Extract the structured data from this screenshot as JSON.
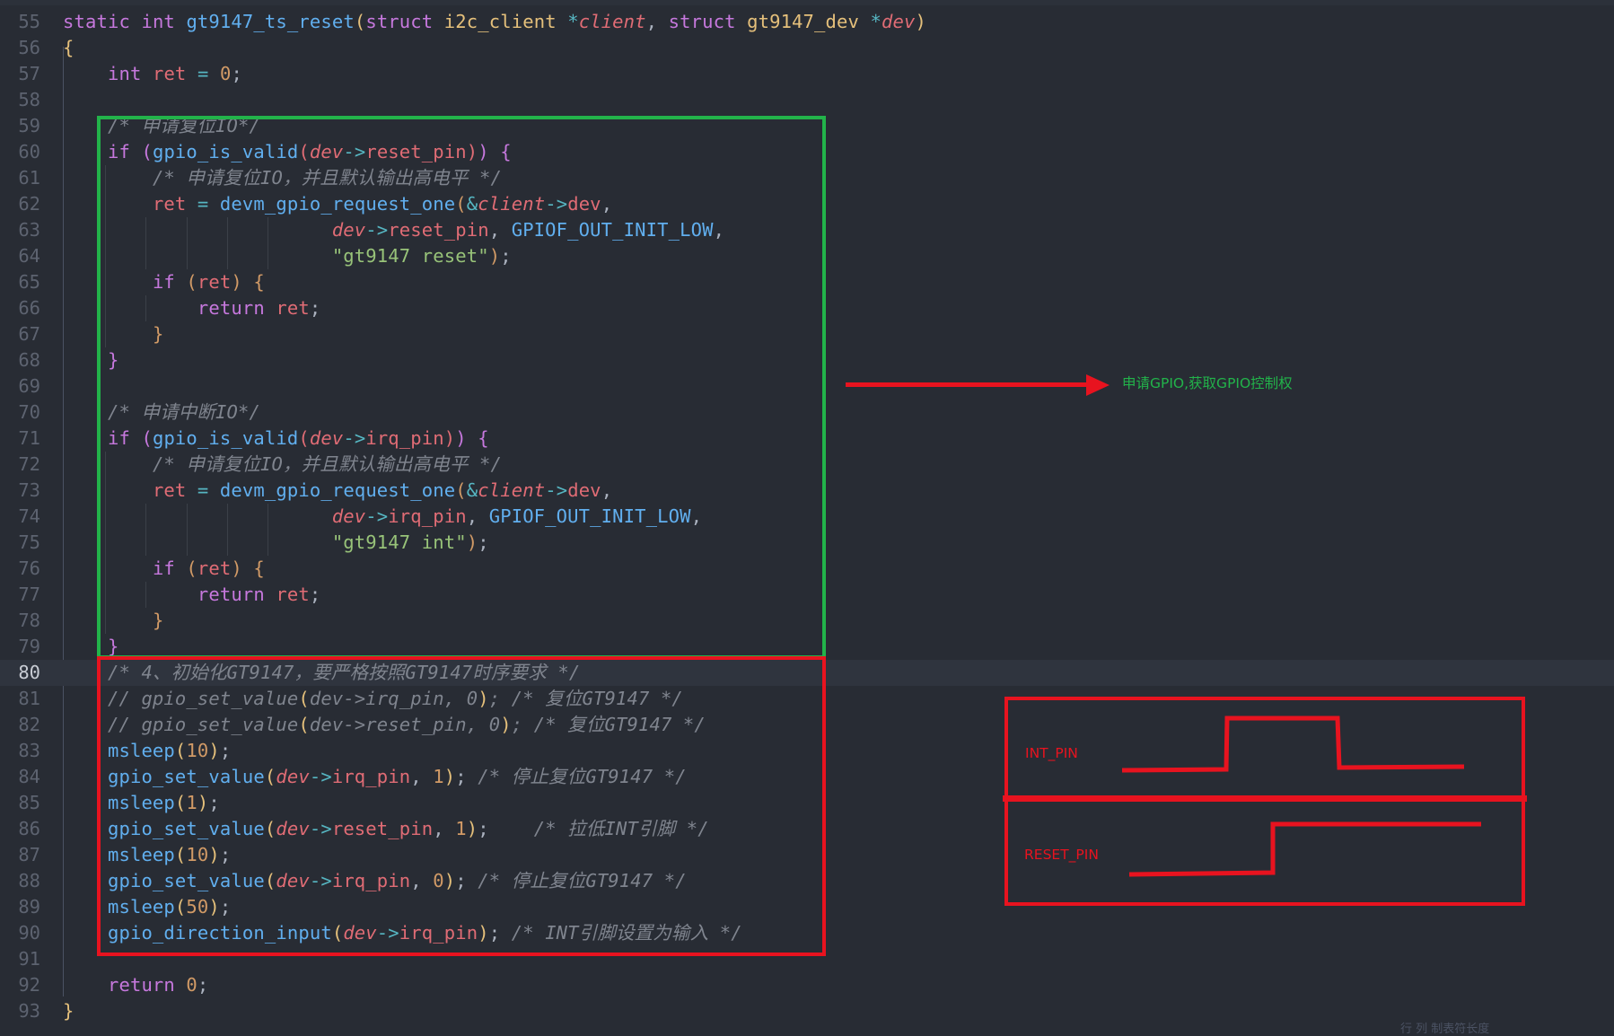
{
  "editor": {
    "current_line": "80",
    "lines": [
      {
        "no": "55",
        "tokens": [
          {
            "t": "static",
            "c": "kw"
          },
          {
            "t": " "
          },
          {
            "t": "int",
            "c": "ty"
          },
          {
            "t": " "
          },
          {
            "t": "gt9147_ts_reset",
            "c": "fn"
          },
          {
            "t": "(",
            "c": "b1"
          },
          {
            "t": "struct",
            "c": "kw"
          },
          {
            "t": " "
          },
          {
            "t": "i2c_client",
            "c": "st"
          },
          {
            "t": " "
          },
          {
            "t": "*",
            "c": "op"
          },
          {
            "t": "client",
            "c": "pa"
          },
          {
            "t": ", "
          },
          {
            "t": "struct",
            "c": "kw"
          },
          {
            "t": " "
          },
          {
            "t": "gt9147_dev",
            "c": "st"
          },
          {
            "t": " "
          },
          {
            "t": "*",
            "c": "op"
          },
          {
            "t": "dev",
            "c": "pa"
          },
          {
            "t": ")",
            "c": "b1"
          }
        ]
      },
      {
        "no": "56",
        "tokens": [
          {
            "t": "{",
            "c": "b1"
          }
        ]
      },
      {
        "no": "57",
        "tokens": [
          {
            "t": "    "
          },
          {
            "t": "int",
            "c": "ty"
          },
          {
            "t": " "
          },
          {
            "t": "ret",
            "c": "vr"
          },
          {
            "t": " "
          },
          {
            "t": "=",
            "c": "op"
          },
          {
            "t": " "
          },
          {
            "t": "0",
            "c": "nu"
          },
          {
            "t": ";"
          }
        ]
      },
      {
        "no": "58",
        "tokens": []
      },
      {
        "no": "59",
        "tokens": [
          {
            "t": "    "
          },
          {
            "t": "/* 申请复位IO*/",
            "c": "cm"
          }
        ]
      },
      {
        "no": "60",
        "tokens": [
          {
            "t": "    "
          },
          {
            "t": "if",
            "c": "kw"
          },
          {
            "t": " "
          },
          {
            "t": "(",
            "c": "b2"
          },
          {
            "t": "gpio_is_valid",
            "c": "fn"
          },
          {
            "t": "(",
            "c": "b4"
          },
          {
            "t": "dev",
            "c": "pa"
          },
          {
            "t": "->",
            "c": "op"
          },
          {
            "t": "reset_pin",
            "c": "mb"
          },
          {
            "t": ")",
            "c": "b4"
          },
          {
            "t": ")",
            "c": "b2"
          },
          {
            "t": " "
          },
          {
            "t": "{",
            "c": "b2"
          }
        ]
      },
      {
        "no": "61",
        "tokens": [
          {
            "t": "        "
          },
          {
            "t": "/* 申请复位IO，并且默认输出高电平 */",
            "c": "cm"
          }
        ]
      },
      {
        "no": "62",
        "tokens": [
          {
            "t": "        "
          },
          {
            "t": "ret",
            "c": "vr"
          },
          {
            "t": " "
          },
          {
            "t": "=",
            "c": "op"
          },
          {
            "t": " "
          },
          {
            "t": "devm_gpio_request_one",
            "c": "fn"
          },
          {
            "t": "(",
            "c": "b3"
          },
          {
            "t": "&",
            "c": "op"
          },
          {
            "t": "client",
            "c": "pa"
          },
          {
            "t": "->",
            "c": "op"
          },
          {
            "t": "dev",
            "c": "mb"
          },
          {
            "t": ","
          }
        ]
      },
      {
        "no": "63",
        "tokens": [
          {
            "t": "                        "
          },
          {
            "t": "dev",
            "c": "pa"
          },
          {
            "t": "->",
            "c": "op"
          },
          {
            "t": "reset_pin",
            "c": "mb"
          },
          {
            "t": ", "
          },
          {
            "t": "GPIOF_OUT_INIT_LOW",
            "c": "cn"
          },
          {
            "t": ","
          }
        ]
      },
      {
        "no": "64",
        "tokens": [
          {
            "t": "                        "
          },
          {
            "t": "\"gt9147 reset\"",
            "c": "s"
          },
          {
            "t": ")",
            "c": "b3"
          },
          {
            "t": ";"
          }
        ]
      },
      {
        "no": "65",
        "tokens": [
          {
            "t": "        "
          },
          {
            "t": "if",
            "c": "kw"
          },
          {
            "t": " "
          },
          {
            "t": "(",
            "c": "b3"
          },
          {
            "t": "ret",
            "c": "vr"
          },
          {
            "t": ")",
            "c": "b3"
          },
          {
            "t": " "
          },
          {
            "t": "{",
            "c": "b3"
          }
        ]
      },
      {
        "no": "66",
        "tokens": [
          {
            "t": "            "
          },
          {
            "t": "return",
            "c": "kw"
          },
          {
            "t": " "
          },
          {
            "t": "ret",
            "c": "vr"
          },
          {
            "t": ";"
          }
        ]
      },
      {
        "no": "67",
        "tokens": [
          {
            "t": "        "
          },
          {
            "t": "}",
            "c": "b3"
          }
        ]
      },
      {
        "no": "68",
        "tokens": [
          {
            "t": "    "
          },
          {
            "t": "}",
            "c": "b2"
          }
        ]
      },
      {
        "no": "69",
        "tokens": []
      },
      {
        "no": "70",
        "tokens": [
          {
            "t": "    "
          },
          {
            "t": "/* 申请中断IO*/",
            "c": "cm"
          }
        ]
      },
      {
        "no": "71",
        "tokens": [
          {
            "t": "    "
          },
          {
            "t": "if",
            "c": "kw"
          },
          {
            "t": " "
          },
          {
            "t": "(",
            "c": "b2"
          },
          {
            "t": "gpio_is_valid",
            "c": "fn"
          },
          {
            "t": "(",
            "c": "b4"
          },
          {
            "t": "dev",
            "c": "pa"
          },
          {
            "t": "->",
            "c": "op"
          },
          {
            "t": "irq_pin",
            "c": "mb"
          },
          {
            "t": ")",
            "c": "b4"
          },
          {
            "t": ")",
            "c": "b2"
          },
          {
            "t": " "
          },
          {
            "t": "{",
            "c": "b2"
          }
        ]
      },
      {
        "no": "72",
        "tokens": [
          {
            "t": "        "
          },
          {
            "t": "/* 申请复位IO，并且默认输出高电平 */",
            "c": "cm"
          }
        ]
      },
      {
        "no": "73",
        "tokens": [
          {
            "t": "        "
          },
          {
            "t": "ret",
            "c": "vr"
          },
          {
            "t": " "
          },
          {
            "t": "=",
            "c": "op"
          },
          {
            "t": " "
          },
          {
            "t": "devm_gpio_request_one",
            "c": "fn"
          },
          {
            "t": "(",
            "c": "b3"
          },
          {
            "t": "&",
            "c": "op"
          },
          {
            "t": "client",
            "c": "pa"
          },
          {
            "t": "->",
            "c": "op"
          },
          {
            "t": "dev",
            "c": "mb"
          },
          {
            "t": ","
          }
        ]
      },
      {
        "no": "74",
        "tokens": [
          {
            "t": "                        "
          },
          {
            "t": "dev",
            "c": "pa"
          },
          {
            "t": "->",
            "c": "op"
          },
          {
            "t": "irq_pin",
            "c": "mb"
          },
          {
            "t": ", "
          },
          {
            "t": "GPIOF_OUT_INIT_LOW",
            "c": "cn"
          },
          {
            "t": ","
          }
        ]
      },
      {
        "no": "75",
        "tokens": [
          {
            "t": "                        "
          },
          {
            "t": "\"gt9147 int\"",
            "c": "s"
          },
          {
            "t": ")",
            "c": "b3"
          },
          {
            "t": ";"
          }
        ]
      },
      {
        "no": "76",
        "tokens": [
          {
            "t": "        "
          },
          {
            "t": "if",
            "c": "kw"
          },
          {
            "t": " "
          },
          {
            "t": "(",
            "c": "b3"
          },
          {
            "t": "ret",
            "c": "vr"
          },
          {
            "t": ")",
            "c": "b3"
          },
          {
            "t": " "
          },
          {
            "t": "{",
            "c": "b3"
          }
        ]
      },
      {
        "no": "77",
        "tokens": [
          {
            "t": "            "
          },
          {
            "t": "return",
            "c": "kw"
          },
          {
            "t": " "
          },
          {
            "t": "ret",
            "c": "vr"
          },
          {
            "t": ";"
          }
        ]
      },
      {
        "no": "78",
        "tokens": [
          {
            "t": "        "
          },
          {
            "t": "}",
            "c": "b3"
          }
        ]
      },
      {
        "no": "79",
        "tokens": [
          {
            "t": "    "
          },
          {
            "t": "}",
            "c": "b2"
          }
        ]
      },
      {
        "no": "80",
        "tokens": [
          {
            "t": "    "
          },
          {
            "t": "/* 4、初始化GT9147，要严格按照GT9147时序要求 */",
            "c": "cm"
          }
        ]
      },
      {
        "no": "81",
        "tokens": [
          {
            "t": "    "
          },
          {
            "t": "// gpio_set_value",
            "c": "cm"
          },
          {
            "t": "(",
            "c": "b1"
          },
          {
            "t": "dev->irq_pin, 0",
            "c": "cm"
          },
          {
            "t": ")",
            "c": "b1"
          },
          {
            "t": "; /* 复位GT9147 */",
            "c": "cm"
          }
        ]
      },
      {
        "no": "82",
        "tokens": [
          {
            "t": "    "
          },
          {
            "t": "// gpio_set_value",
            "c": "cm"
          },
          {
            "t": "(",
            "c": "b1"
          },
          {
            "t": "dev->reset_pin, 0",
            "c": "cm"
          },
          {
            "t": ")",
            "c": "b1"
          },
          {
            "t": "; /* 复位GT9147 */",
            "c": "cm"
          }
        ]
      },
      {
        "no": "83",
        "tokens": [
          {
            "t": "    "
          },
          {
            "t": "msleep",
            "c": "fn"
          },
          {
            "t": "(",
            "c": "b1"
          },
          {
            "t": "10",
            "c": "nu"
          },
          {
            "t": ")",
            "c": "b1"
          },
          {
            "t": ";"
          }
        ]
      },
      {
        "no": "84",
        "tokens": [
          {
            "t": "    "
          },
          {
            "t": "gpio_set_value",
            "c": "fn"
          },
          {
            "t": "(",
            "c": "b1"
          },
          {
            "t": "dev",
            "c": "pa"
          },
          {
            "t": "->",
            "c": "op"
          },
          {
            "t": "irq_pin",
            "c": "mb"
          },
          {
            "t": ", "
          },
          {
            "t": "1",
            "c": "nu"
          },
          {
            "t": ")",
            "c": "b1"
          },
          {
            "t": "; "
          },
          {
            "t": "/* 停止复位GT9147 */",
            "c": "cm"
          }
        ]
      },
      {
        "no": "85",
        "tokens": [
          {
            "t": "    "
          },
          {
            "t": "msleep",
            "c": "fn"
          },
          {
            "t": "(",
            "c": "b1"
          },
          {
            "t": "1",
            "c": "nu"
          },
          {
            "t": ")",
            "c": "b1"
          },
          {
            "t": ";"
          }
        ]
      },
      {
        "no": "86",
        "tokens": [
          {
            "t": "    "
          },
          {
            "t": "gpio_set_value",
            "c": "fn"
          },
          {
            "t": "(",
            "c": "b1"
          },
          {
            "t": "dev",
            "c": "pa"
          },
          {
            "t": "->",
            "c": "op"
          },
          {
            "t": "reset_pin",
            "c": "mb"
          },
          {
            "t": ", "
          },
          {
            "t": "1",
            "c": "nu"
          },
          {
            "t": ")",
            "c": "b1"
          },
          {
            "t": ";    "
          },
          {
            "t": "/* 拉低INT引脚 */",
            "c": "cm"
          }
        ]
      },
      {
        "no": "87",
        "tokens": [
          {
            "t": "    "
          },
          {
            "t": "msleep",
            "c": "fn"
          },
          {
            "t": "(",
            "c": "b1"
          },
          {
            "t": "10",
            "c": "nu"
          },
          {
            "t": ")",
            "c": "b1"
          },
          {
            "t": ";"
          }
        ]
      },
      {
        "no": "88",
        "tokens": [
          {
            "t": "    "
          },
          {
            "t": "gpio_set_value",
            "c": "fn"
          },
          {
            "t": "(",
            "c": "b1"
          },
          {
            "t": "dev",
            "c": "pa"
          },
          {
            "t": "->",
            "c": "op"
          },
          {
            "t": "irq_pin",
            "c": "mb"
          },
          {
            "t": ", "
          },
          {
            "t": "0",
            "c": "nu"
          },
          {
            "t": ")",
            "c": "b1"
          },
          {
            "t": "; "
          },
          {
            "t": "/* 停止复位GT9147 */",
            "c": "cm"
          }
        ]
      },
      {
        "no": "89",
        "tokens": [
          {
            "t": "    "
          },
          {
            "t": "msleep",
            "c": "fn"
          },
          {
            "t": "(",
            "c": "b1"
          },
          {
            "t": "50",
            "c": "nu"
          },
          {
            "t": ")",
            "c": "b1"
          },
          {
            "t": ";"
          }
        ]
      },
      {
        "no": "90",
        "tokens": [
          {
            "t": "    "
          },
          {
            "t": "gpio_direction_input",
            "c": "fn"
          },
          {
            "t": "(",
            "c": "b1"
          },
          {
            "t": "dev",
            "c": "pa"
          },
          {
            "t": "->",
            "c": "op"
          },
          {
            "t": "irq_pin",
            "c": "mb"
          },
          {
            "t": ")",
            "c": "b1"
          },
          {
            "t": "; "
          },
          {
            "t": "/* INT引脚设置为输入 */",
            "c": "cm"
          }
        ]
      },
      {
        "no": "91",
        "tokens": []
      },
      {
        "no": "92",
        "tokens": [
          {
            "t": "    "
          },
          {
            "t": "return",
            "c": "kw"
          },
          {
            "t": " "
          },
          {
            "t": "0",
            "c": "nu"
          },
          {
            "t": ";"
          }
        ]
      },
      {
        "no": "93",
        "tokens": [
          {
            "t": "}",
            "c": "b1"
          }
        ]
      }
    ]
  },
  "annotations": {
    "gpio_label": "申请GPIO,获取GPIO控制权",
    "int_pin_label": "INT_PIN",
    "reset_pin_label": "RESET_PIN",
    "box_green_color": "#22b34a",
    "box_red_color": "#e8131f"
  },
  "footer": {
    "faded_text": "行    列    制表符长度"
  }
}
